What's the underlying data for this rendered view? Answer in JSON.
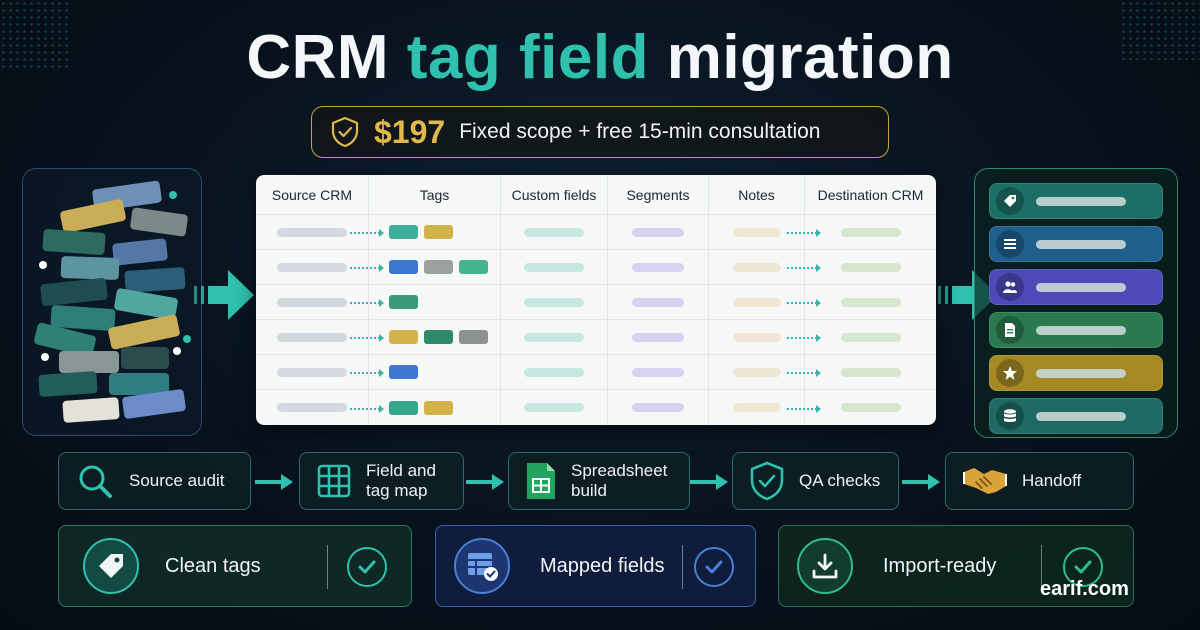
{
  "title": {
    "part1": "CRM",
    "accent": "tag field",
    "part2": "migration"
  },
  "price": {
    "amount": "$197",
    "description": "Fixed scope + free 15-min consultation"
  },
  "table": {
    "columns": [
      "Source CRM",
      "Tags",
      "Custom fields",
      "Segments",
      "Notes",
      "Destination CRM"
    ],
    "rows": [
      {
        "tags": [
          "#3fae98",
          "#d1b24d"
        ]
      },
      {
        "tags": [
          "#3a78d0",
          "#9aa0a0",
          "#44b38e"
        ]
      },
      {
        "tags": [
          "#3b9a77"
        ]
      },
      {
        "tags": [
          "#d2b24a",
          "#2f8a6a",
          "#8d9290"
        ]
      },
      {
        "tags": [
          "#3f76d3"
        ]
      },
      {
        "tags": [
          "#36a68c",
          "#d3b34a"
        ]
      }
    ]
  },
  "destination_panel": {
    "items": [
      {
        "icon": "tag-icon",
        "color": "#1c6f66"
      },
      {
        "icon": "list-icon",
        "color": "#1f5f8c"
      },
      {
        "icon": "users-icon",
        "color": "#4b4ab8"
      },
      {
        "icon": "document-icon",
        "color": "#2b7a4f"
      },
      {
        "icon": "star-icon",
        "color": "#a58a24"
      },
      {
        "icon": "database-icon",
        "color": "#1e6a63"
      }
    ]
  },
  "steps": [
    {
      "label": "Source audit",
      "icon": "search-icon"
    },
    {
      "label": "Field and tag map",
      "icon": "grid-icon"
    },
    {
      "label": "Spreadsheet build",
      "icon": "spreadsheet-icon"
    },
    {
      "label": "QA checks",
      "icon": "shield-check-icon"
    },
    {
      "label": "Handoff",
      "icon": "handshake-icon"
    }
  ],
  "outcomes": [
    {
      "label": "Clean tags",
      "icon": "tag-icon"
    },
    {
      "label": "Mapped fields",
      "icon": "table-check-icon"
    },
    {
      "label": "Import-ready",
      "icon": "download-icon"
    }
  ],
  "watermark": "earif.com",
  "colors": {
    "accent": "#2fc1ad",
    "gold": "#e3b84a",
    "background": "#08121d"
  }
}
